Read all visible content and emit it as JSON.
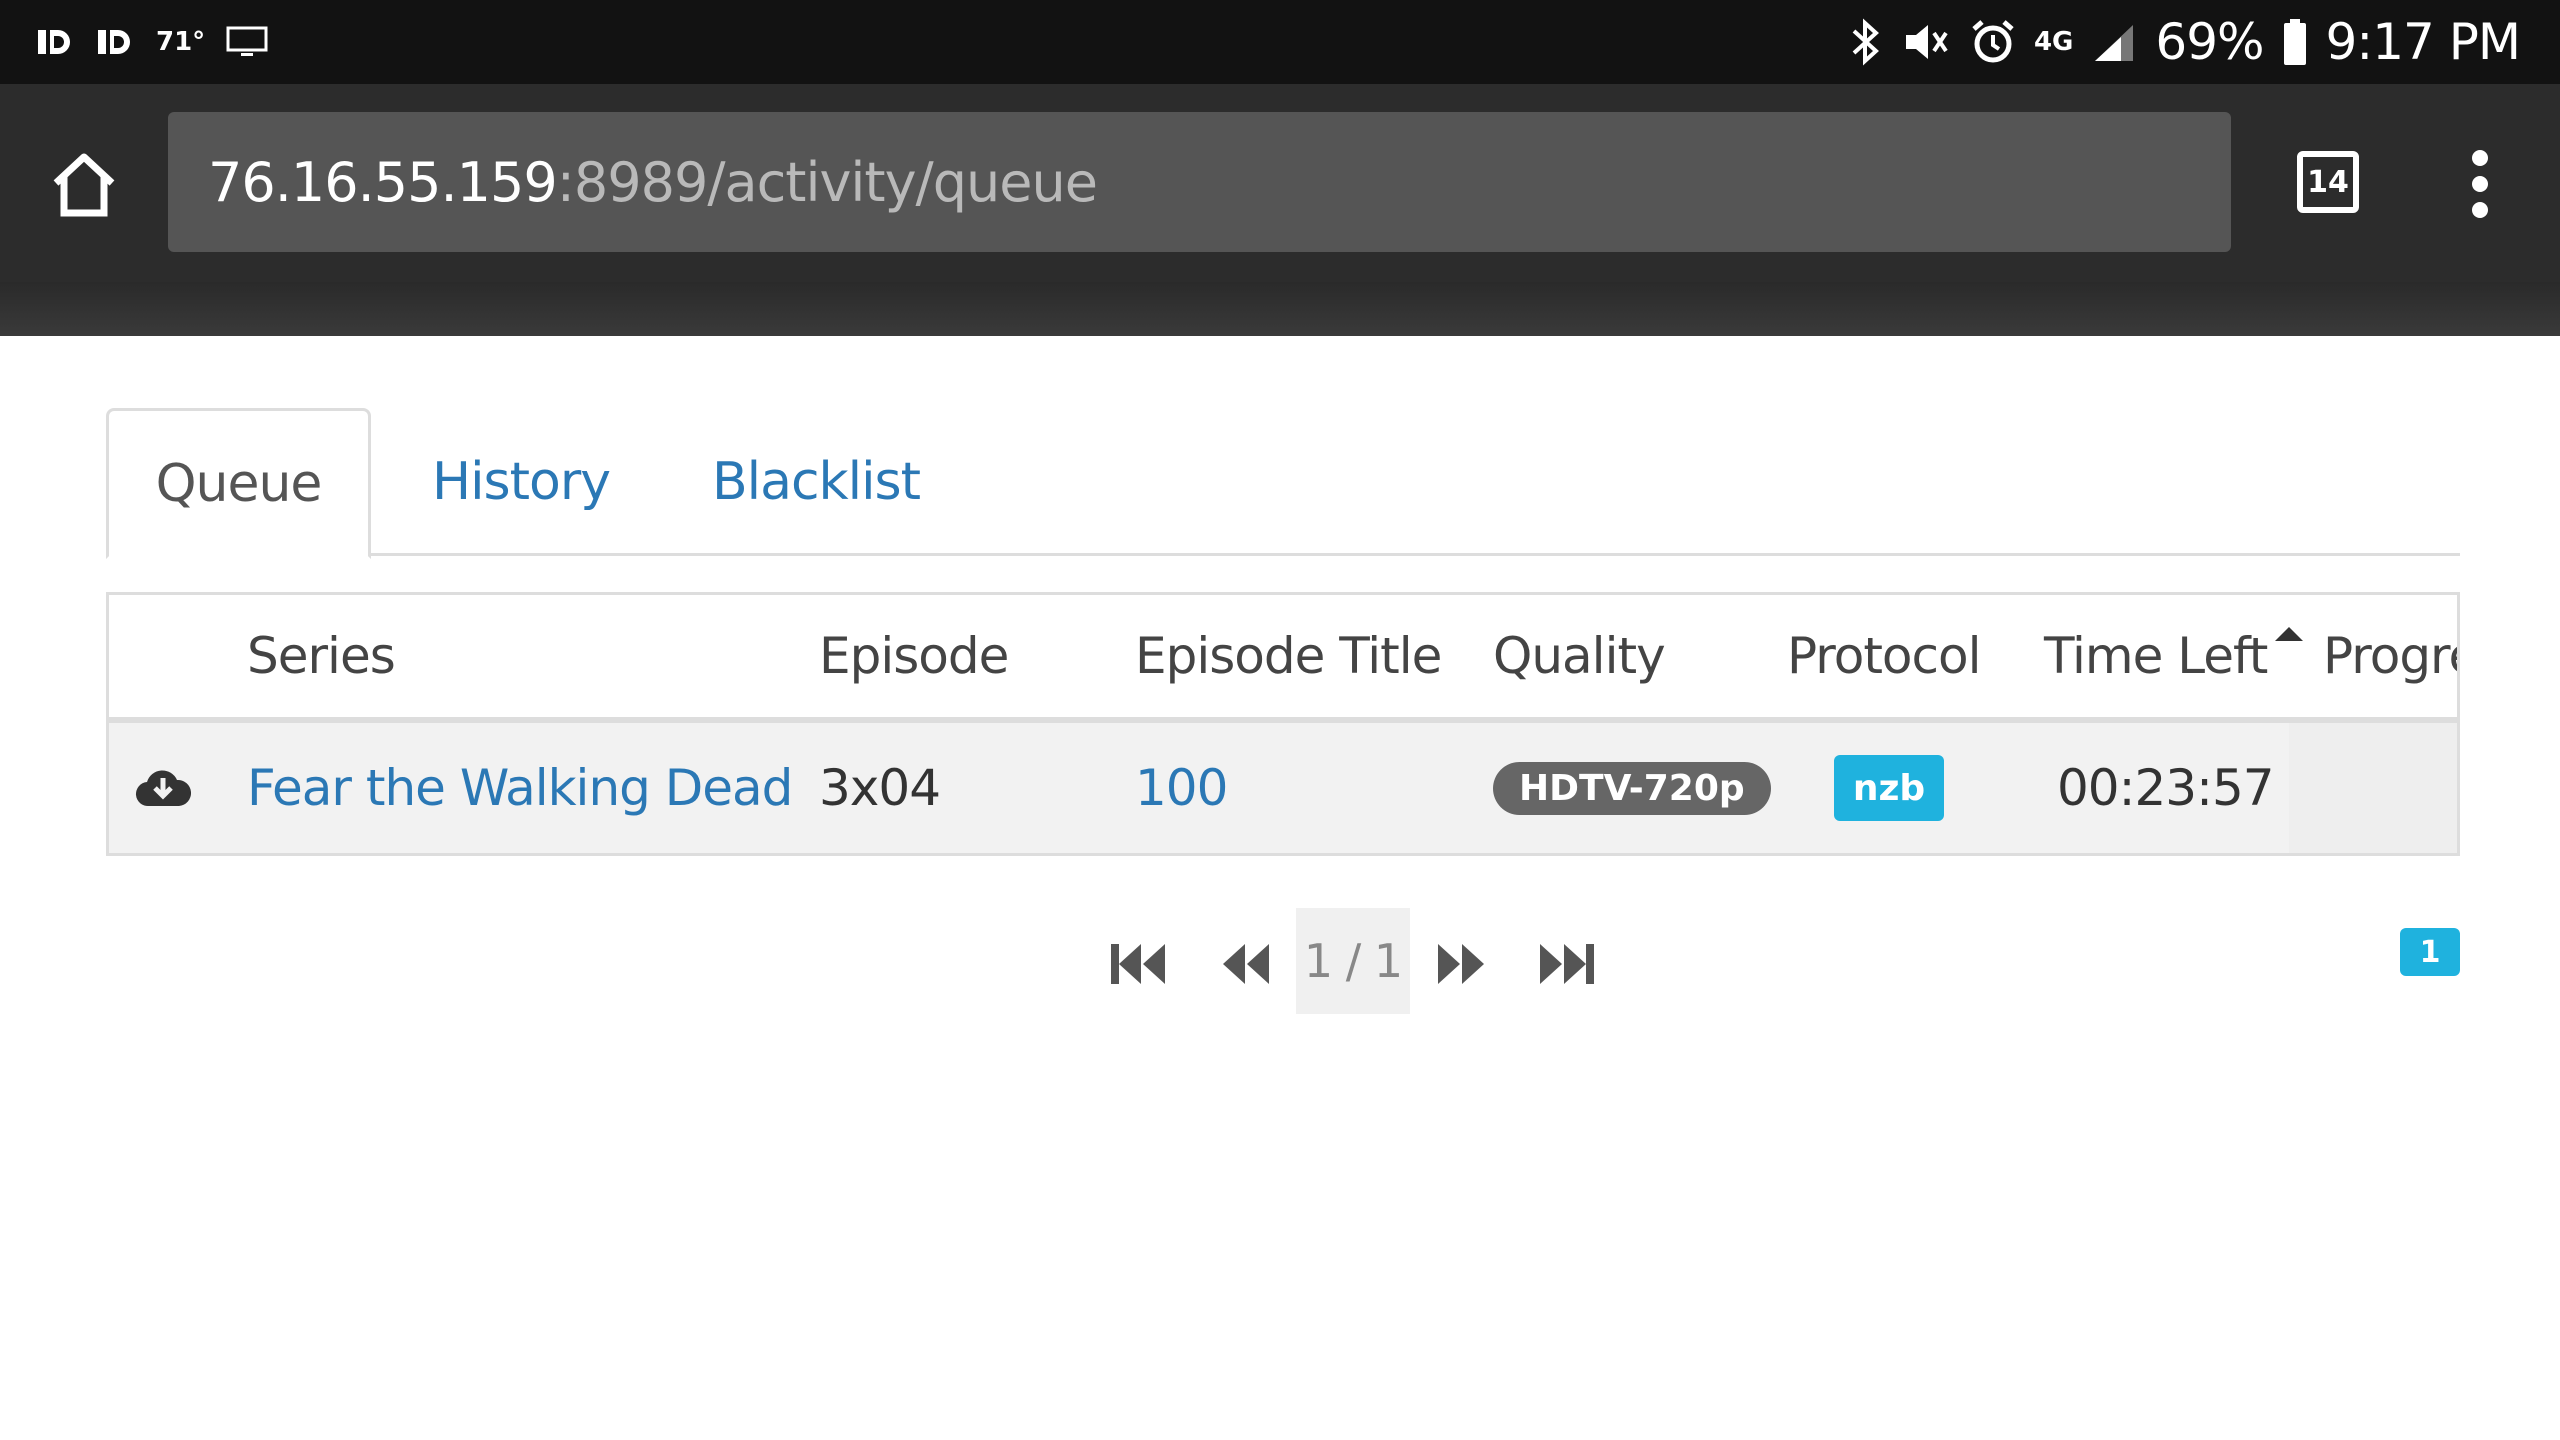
{
  "status_bar": {
    "temperature": "71°",
    "network": "4G",
    "battery_percent": "69%",
    "time": "9:17 PM"
  },
  "browser": {
    "url_host": "76.16.55.159",
    "url_path": ":8989/activity/queue",
    "tab_count": "14"
  },
  "tabs": [
    {
      "label": "Queue",
      "active": true
    },
    {
      "label": "History",
      "active": false
    },
    {
      "label": "Blacklist",
      "active": false
    }
  ],
  "table": {
    "columns": [
      "Series",
      "Episode",
      "Episode Title",
      "Quality",
      "Protocol",
      "Time Left",
      "Progre"
    ],
    "rows": [
      {
        "status_icon": "cloud-download-icon",
        "series": "Fear the Walking Dead",
        "episode": "3x04",
        "episode_title": "100",
        "quality": "HDTV-720p",
        "protocol": "nzb",
        "time_left": "00:23:57"
      }
    ]
  },
  "pager": {
    "status": "1 / 1",
    "total_records": "1"
  },
  "colors": {
    "link": "#2b78b5",
    "badge_info": "#1fb2de",
    "badge_default": "#666666"
  }
}
